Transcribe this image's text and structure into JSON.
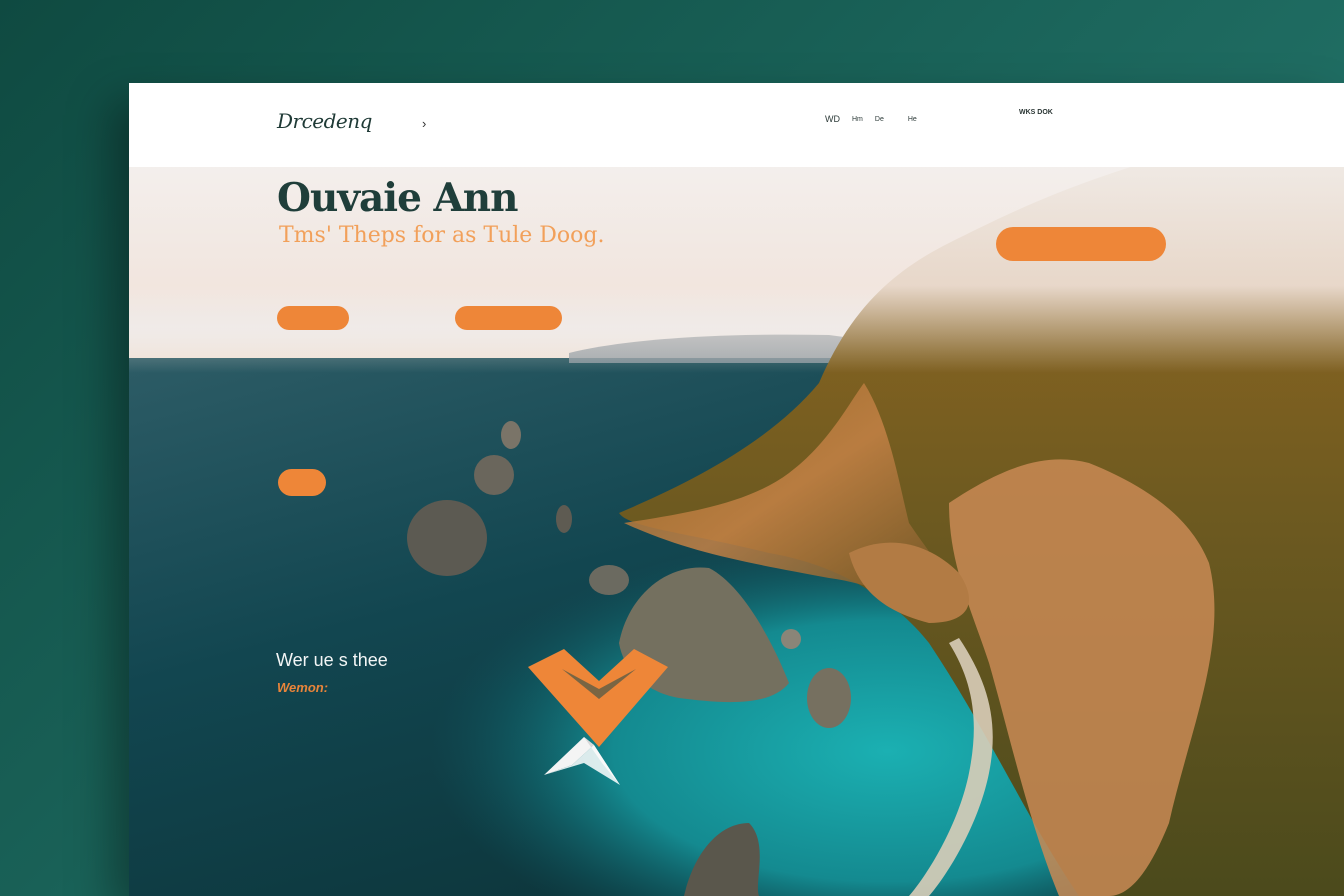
{
  "brand": {
    "logo": "Drcedenq",
    "tagline": ""
  },
  "nav_left": [
    "",
    "",
    ""
  ],
  "nav_right": [
    "WD",
    "Hm",
    "De",
    "",
    "He",
    ""
  ],
  "contact": {
    "title": "WKS DOK",
    "subtitle": "",
    "title2": "",
    "subtitle2": ""
  },
  "hero": {
    "title": "Ouvaie Ann",
    "subtitle": "Tms' Theps for as Tule Doog.",
    "paragraph": "",
    "button1": "",
    "button2": "",
    "button_right": "",
    "button_small": ""
  },
  "side_list": [
    "",
    "",
    "",
    ""
  ],
  "section": {
    "title": "Wer ue s thee",
    "subtitle": "Wemon:",
    "paragraph": "",
    "paragraph2": ""
  },
  "colors": {
    "accent": "#ee8638",
    "dark_teal": "#1f3e3a",
    "background": "#1a6359"
  },
  "icons": [
    "chevron-right-icon",
    "phone-icon",
    "logo-emblem-icon"
  ]
}
